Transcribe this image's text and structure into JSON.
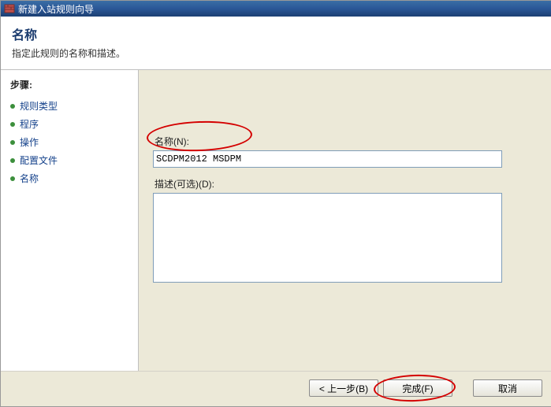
{
  "window": {
    "title": "新建入站规则向导"
  },
  "header": {
    "title": "名称",
    "description": "指定此规则的名称和描述。"
  },
  "sidebar": {
    "steps_heading": "步骤:",
    "items": [
      {
        "label": "规则类型"
      },
      {
        "label": "程序"
      },
      {
        "label": "操作"
      },
      {
        "label": "配置文件"
      },
      {
        "label": "名称"
      }
    ]
  },
  "form": {
    "name_label": "名称(N):",
    "name_value": "SCDPM2012 MSDPM",
    "desc_label": "描述(可选)(D):",
    "desc_value": ""
  },
  "buttons": {
    "back": "< 上一步(B)",
    "finish": "完成(F)",
    "cancel": "取消"
  }
}
